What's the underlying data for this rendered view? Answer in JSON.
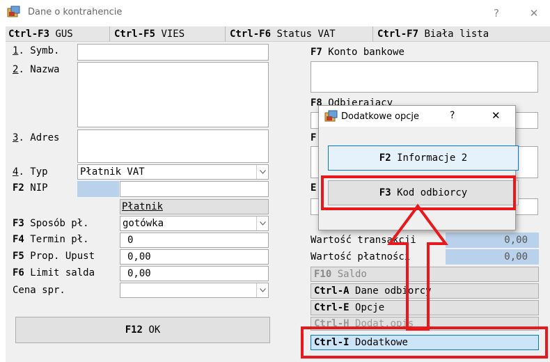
{
  "window": {
    "title": "Dane o kontrahencie",
    "help_label": "?",
    "close_label": "✕"
  },
  "toolbar": {
    "gus_key": "Ctrl-F3",
    "gus_label": "GUS",
    "vies_key": "Ctrl-F5",
    "vies_label": "VIES",
    "vat_key": "Ctrl-F6",
    "vat_label": "Status VAT",
    "biala_key": "Ctrl-F7",
    "biala_label": "Biała lista"
  },
  "form": {
    "symb_num": "1",
    "symb_label": ". Symb.",
    "nazwa_num": "2",
    "nazwa_label": ". Nazwa",
    "adres_num": "3",
    "adres_label": ". Adres",
    "typ_num": "4",
    "typ_label": ". Typ",
    "typ_value": "Płatnik VAT",
    "nip_key": "F2",
    "nip_label": "NIP",
    "platnik_label": "Płatnik",
    "sposob_key": "F3",
    "sposob_label": "Sposób pł.",
    "sposob_value": "gotówka",
    "termin_key": "F4",
    "termin_label": "Termin pł.",
    "termin_value": "0",
    "prop_key": "F5",
    "prop_label": "Prop. Upust",
    "prop_value": "0,00",
    "limit_key": "F6",
    "limit_label": "Limit salda",
    "limit_value": "0,00",
    "cena_label": "Cena spr."
  },
  "ok_button": {
    "key": "F12",
    "label": "OK"
  },
  "right": {
    "konto_key": "F7",
    "konto_label": "Konto bankowe",
    "odbierajacy_key": "F8",
    "odbierajacy_label": "Odbierajacy",
    "f9_partial": "F",
    "e_partial": "E",
    "wart_trans_label": "Wartość transakcji",
    "wart_trans_value": "0,00",
    "wart_plat_label": "Wartość płatności",
    "wart_plat_value": "0,00",
    "saldo_key": "F10",
    "saldo_label": "Saldo",
    "dane_odb_key": "Ctrl-A",
    "dane_odb_label": "Dane odbiorcy",
    "opcje_key": "Ctrl-E",
    "opcje_label": "Opcje",
    "dodat_opis_key": "Ctrl-H",
    "dodat_opis_label": "Dodat.opis",
    "dodatkowe_key": "Ctrl-I",
    "dodatkowe_label": "Dodatkowe"
  },
  "dialog": {
    "title": "Dodatkowe opcje",
    "help_label": "?",
    "close_label": "✕",
    "info_key": "F2",
    "info_label": "Informacje 2",
    "kod_key": "F3",
    "kod_label": "Kod odbiorcy"
  },
  "colors": {
    "annotation_red": "#e8191d",
    "field_blue": "#b9d1ea",
    "focus_blue": "#cce4f7"
  }
}
